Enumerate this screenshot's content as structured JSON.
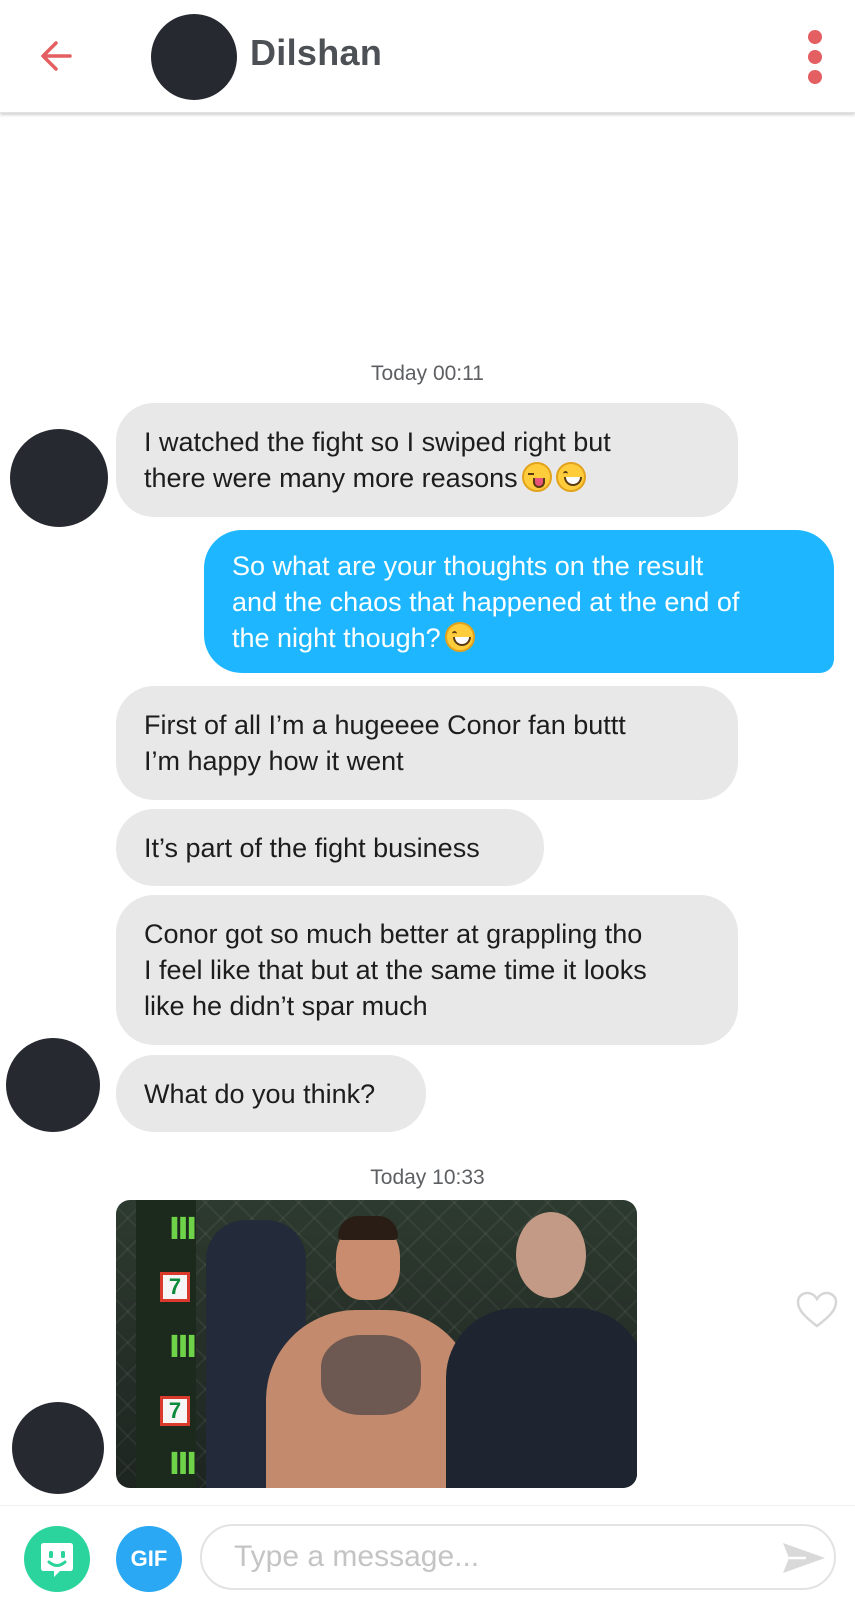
{
  "header": {
    "contact_name": "Dilshan",
    "back_icon": "arrow-left-icon",
    "menu_icon": "kebab-menu-icon",
    "accent_color": "#e35f62"
  },
  "conversation": {
    "timestamp_1": {
      "day": "Today",
      "time": "00:11"
    },
    "timestamp_2": {
      "day": "Today",
      "time": "10:33"
    },
    "messages": [
      {
        "direction": "incoming",
        "text": "I watched the fight so I swiped right but\nthere were many more reasons",
        "emojis": [
          "winking-tongue-emoji",
          "grinning-emoji"
        ]
      },
      {
        "direction": "outgoing",
        "text": "So what are your thoughts on the result\nand the chaos that happened at the end of\nthe night though?",
        "emojis": [
          "grinning-emoji"
        ]
      },
      {
        "direction": "incoming",
        "text": "First of all I’m a hugeeee Conor fan buttt\nI’m happy how it went"
      },
      {
        "direction": "incoming",
        "text": "It’s part of the fight business"
      },
      {
        "direction": "incoming",
        "text": "Conor got so much better at grappling tho\nI feel like that but at the same time it looks\nlike he didn’t spar much"
      },
      {
        "direction": "incoming",
        "text": "What do you think?"
      }
    ],
    "gif_message": {
      "type": "gif",
      "subject": "fighter-in-octagon"
    },
    "like_icon": "heart-outline-icon"
  },
  "composer": {
    "bitmoji_icon": "bitmoji-icon",
    "gif_label": "GIF",
    "placeholder": "Type a message...",
    "value": "",
    "send_icon": "send-arrow-icon"
  },
  "colors": {
    "incoming_bubble": "#e8e8e8",
    "outgoing_bubble": "#1eb7ff",
    "avatar": "#262a30"
  }
}
